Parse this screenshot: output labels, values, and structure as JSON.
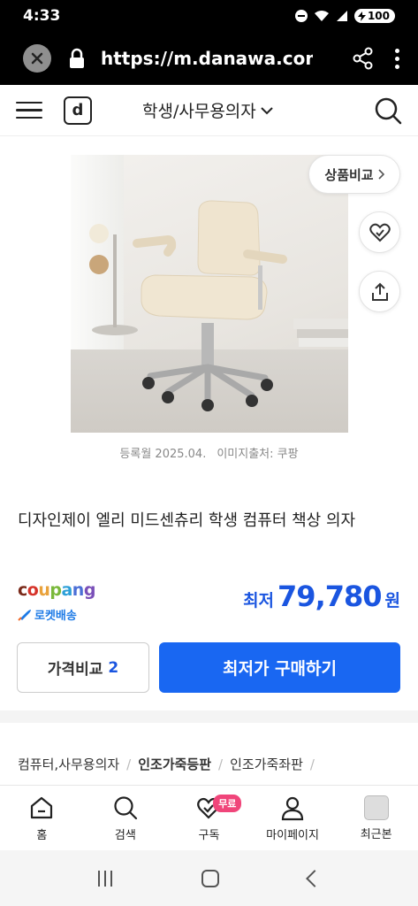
{
  "status": {
    "time": "4:33",
    "battery": "100"
  },
  "browser": {
    "url": "https://m.danawa.com/p"
  },
  "header": {
    "logo": "d",
    "category": "학생/사무용의자"
  },
  "gallery": {
    "compare_label": "상품비교",
    "registered": "등록월 2025.04.",
    "image_source": "이미지출처: 쿠팡"
  },
  "product": {
    "name": "디자인제이 엘리 미드센츄리 학생 컴퓨터 책상 의자",
    "seller": "coupang",
    "delivery": "로켓배송",
    "price_label": "최저",
    "price": "79,780",
    "price_unit": "원"
  },
  "actions": {
    "compare_label": "가격비교",
    "compare_count": "2",
    "buy_label": "최저가 구매하기"
  },
  "breadcrumb": [
    "컴퓨터,사무용의자",
    "인조가죽등판",
    "인조가죽좌판"
  ],
  "bottom_nav": [
    {
      "label": "홈",
      "icon": "home-icon"
    },
    {
      "label": "검색",
      "icon": "search-icon"
    },
    {
      "label": "구독",
      "icon": "heart-check-icon",
      "badge": "무료"
    },
    {
      "label": "마이페이지",
      "icon": "person-icon"
    },
    {
      "label": "최근본",
      "icon": "recent-thumb"
    }
  ],
  "colors": {
    "accent": "#1967f2",
    "price": "#1a55e0",
    "badge": "#f0457a",
    "rocket": "#1f7be6"
  }
}
